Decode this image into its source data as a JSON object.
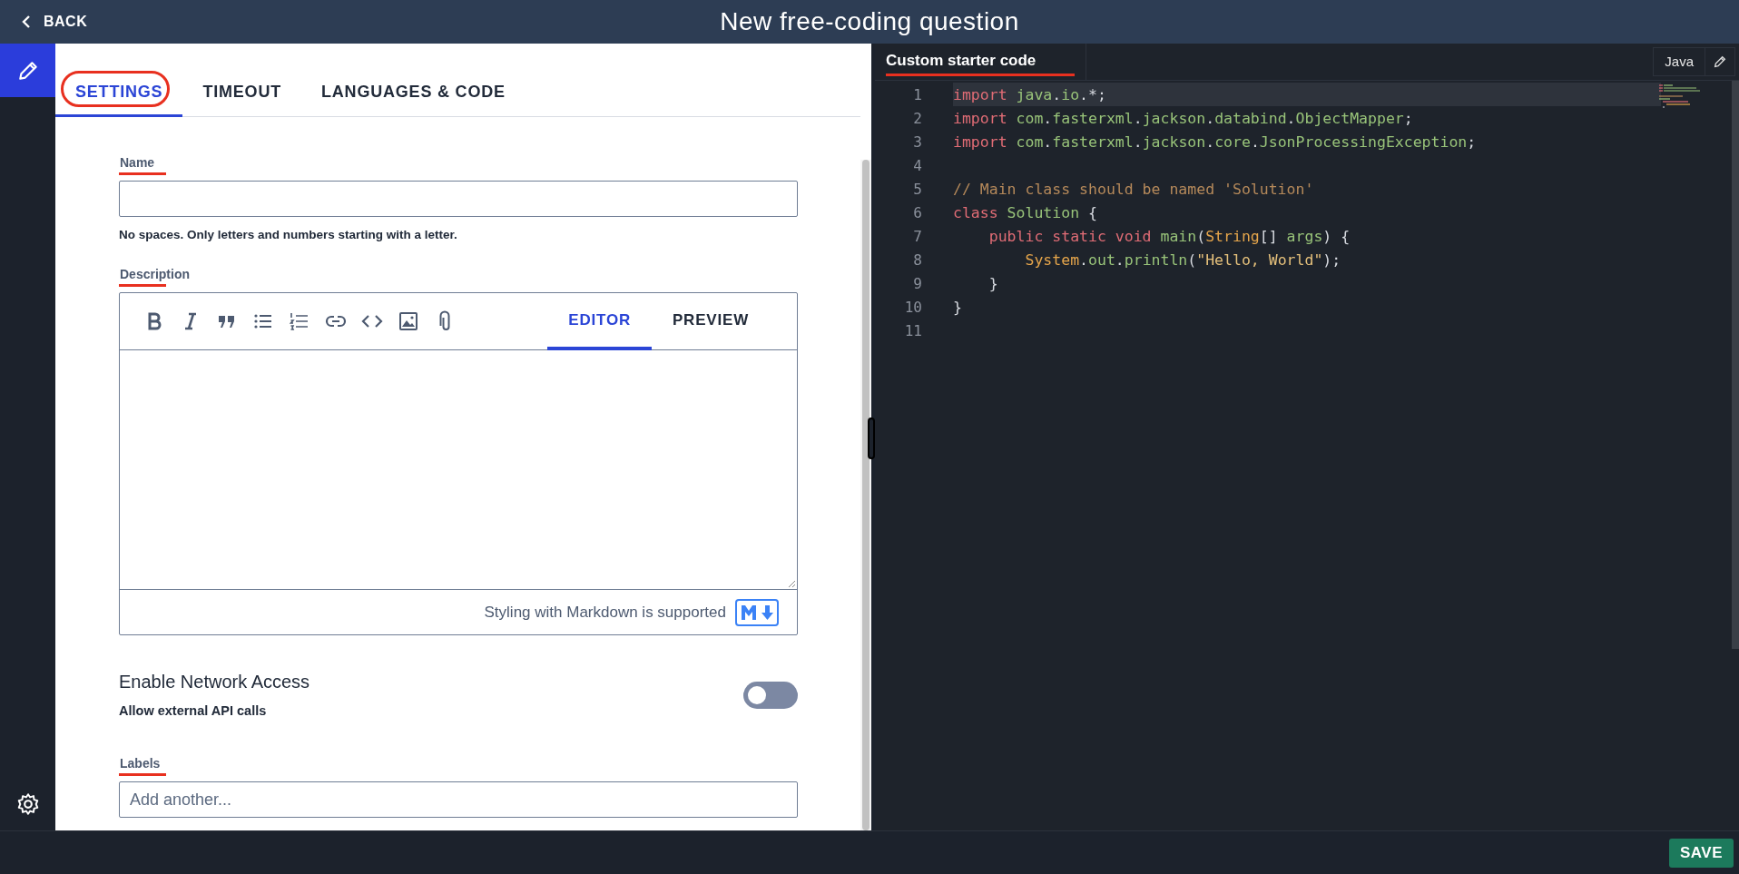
{
  "header": {
    "back": "BACK",
    "title": "New free-coding question"
  },
  "tabs": [
    {
      "label": "SETTINGS",
      "selected": true
    },
    {
      "label": "TIMEOUT",
      "selected": false
    },
    {
      "label": "LANGUAGES & CODE",
      "selected": false
    }
  ],
  "name_field": {
    "label": "Name",
    "hint": "No spaces. Only letters and numbers starting with a letter."
  },
  "description": {
    "label": "Description",
    "tabs": [
      {
        "label": "EDITOR",
        "selected": true
      },
      {
        "label": "PREVIEW",
        "selected": false
      }
    ],
    "footer": "Styling with Markdown is supported"
  },
  "network": {
    "title": "Enable Network Access",
    "subtitle": "Allow external API calls",
    "on": false
  },
  "labels_field": {
    "label": "Labels",
    "placeholder": "Add another..."
  },
  "code_panel": {
    "tab": "Custom starter code",
    "language": "Java",
    "lines": [
      {
        "number": "1",
        "selected": true,
        "tokens": [
          {
            "text": "import ",
            "kind": "keyword"
          },
          {
            "text": "java",
            "kind": "name"
          },
          {
            "text": ".",
            "kind": "plain"
          },
          {
            "text": "io",
            "kind": "name"
          },
          {
            "text": ".*;",
            "kind": "plain"
          }
        ]
      },
      {
        "number": "2",
        "selected": false,
        "tokens": [
          {
            "text": "import ",
            "kind": "keyword"
          },
          {
            "text": "com",
            "kind": "name"
          },
          {
            "text": ".",
            "kind": "plain"
          },
          {
            "text": "fasterxml",
            "kind": "name"
          },
          {
            "text": ".",
            "kind": "plain"
          },
          {
            "text": "jackson",
            "kind": "name"
          },
          {
            "text": ".",
            "kind": "plain"
          },
          {
            "text": "databind",
            "kind": "name"
          },
          {
            "text": ".",
            "kind": "plain"
          },
          {
            "text": "ObjectMapper",
            "kind": "name"
          },
          {
            "text": ";",
            "kind": "plain"
          }
        ]
      },
      {
        "number": "3",
        "selected": false,
        "tokens": [
          {
            "text": "import ",
            "kind": "keyword"
          },
          {
            "text": "com",
            "kind": "name"
          },
          {
            "text": ".",
            "kind": "plain"
          },
          {
            "text": "fasterxml",
            "kind": "name"
          },
          {
            "text": ".",
            "kind": "plain"
          },
          {
            "text": "jackson",
            "kind": "name"
          },
          {
            "text": ".",
            "kind": "plain"
          },
          {
            "text": "core",
            "kind": "name"
          },
          {
            "text": ".",
            "kind": "plain"
          },
          {
            "text": "JsonProcessingException",
            "kind": "name"
          },
          {
            "text": ";",
            "kind": "plain"
          }
        ]
      },
      {
        "number": "4",
        "selected": false
      },
      {
        "number": "5",
        "selected": false,
        "tokens": [
          {
            "text": "// Main class should be named 'Solution'",
            "kind": "comment"
          }
        ]
      },
      {
        "number": "6",
        "selected": false,
        "tokens": [
          {
            "text": "class ",
            "kind": "keyword"
          },
          {
            "text": "Solution",
            "kind": "name"
          },
          {
            "text": " {",
            "kind": "plain"
          }
        ]
      },
      {
        "number": "7",
        "selected": false,
        "tokens": [
          {
            "text": "    public static void ",
            "kind": "keyword"
          },
          {
            "text": "main",
            "kind": "name"
          },
          {
            "text": "(",
            "kind": "plain"
          },
          {
            "text": "String",
            "kind": "type"
          },
          {
            "text": "[] ",
            "kind": "plain"
          },
          {
            "text": "args",
            "kind": "name"
          },
          {
            "text": ") {",
            "kind": "plain"
          }
        ]
      },
      {
        "number": "8",
        "selected": false,
        "tokens": [
          {
            "text": "        System",
            "kind": "type"
          },
          {
            "text": ".",
            "kind": "plain"
          },
          {
            "text": "out",
            "kind": "name"
          },
          {
            "text": ".",
            "kind": "plain"
          },
          {
            "text": "println",
            "kind": "name"
          },
          {
            "text": "(",
            "kind": "plain"
          },
          {
            "text": "\"Hello, World\"",
            "kind": "string"
          },
          {
            "text": ");",
            "kind": "plain"
          }
        ]
      },
      {
        "number": "9",
        "selected": false,
        "tokens": [
          {
            "text": "    }",
            "kind": "plain"
          }
        ]
      },
      {
        "number": "10",
        "selected": false,
        "tokens": [
          {
            "text": "}",
            "kind": "plain"
          }
        ]
      },
      {
        "number": "11",
        "selected": false
      }
    ]
  },
  "save": "SAVE"
}
